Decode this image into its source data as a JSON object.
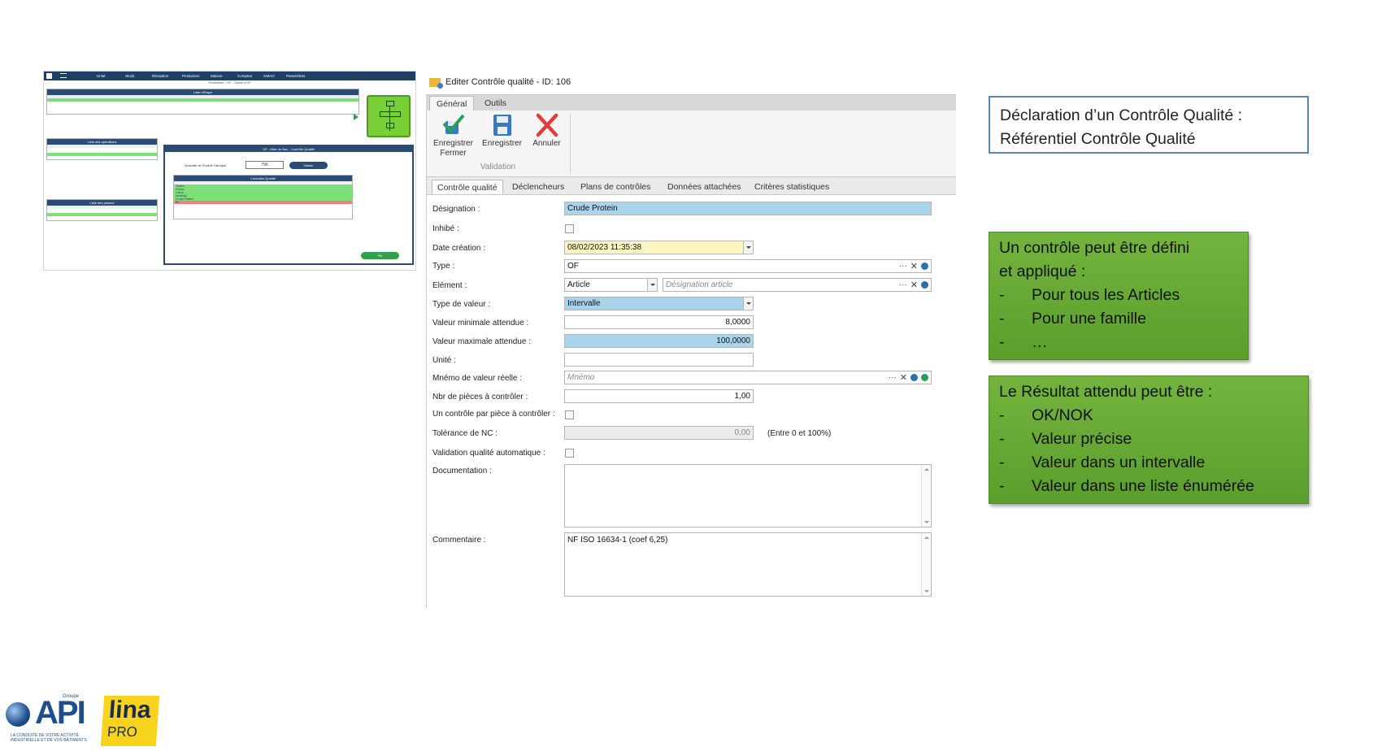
{
  "thumbnail": {
    "nav": [
      "Unité",
      "Stock",
      "Réception",
      "Production",
      "Maison",
      "Comptes",
      "GMAO",
      "Paramètres"
    ],
    "subtitle": "Production - OF - Saisie d'OF",
    "liste_etape_title": "Liste d'Etape",
    "liste_operation_title": "Liste des opérations",
    "liste_phases_title": "Liste des phases",
    "panel_title": "OF - Mise en Bac - Contrôle Qualité",
    "quantite_label": "Quantité de Produit Fabriqué",
    "quantite_value": "790",
    "valider_label": "Valider",
    "controles_title": "Contrôles Qualité",
    "fin_label": "Fin",
    "controle_rows": [
      "Texture",
      "Colour",
      "Odour",
      "Humidity",
      "Crude Protein",
      "Ph"
    ]
  },
  "dialog": {
    "title": "Editer Contrôle qualité - ID: 106",
    "ribbon_tabs": [
      "Général",
      "Outils"
    ],
    "ribbon_buttons": {
      "save_close": "Enregistrer Fermer",
      "save": "Enregistrer",
      "cancel": "Annuler"
    },
    "ribbon_group": "Validation",
    "form_tabs": [
      "Contrôle qualité",
      "Déclencheurs",
      "Plans de contrôles",
      "Données attachées",
      "Critères statistiques"
    ],
    "fields": {
      "designation": {
        "label": "Désignation :",
        "value": "Crude Protein"
      },
      "inhibe": {
        "label": "Inhibé :",
        "checked": false
      },
      "date_creation": {
        "label": "Date création :",
        "value": "08/02/2023 11:35:38"
      },
      "type": {
        "label": "Type :",
        "value": "OF"
      },
      "element": {
        "label": "Elément :",
        "value": "Article",
        "placeholder": "Désignation article"
      },
      "type_valeur": {
        "label": "Type de valeur :",
        "value": "Intervalle"
      },
      "valeur_min": {
        "label": "Valeur minimale attendue :",
        "value": "8,0000"
      },
      "valeur_max": {
        "label": "Valeur maximale attendue :",
        "value": "100,0000"
      },
      "unite": {
        "label": "Unité :",
        "value": ""
      },
      "mnemo": {
        "label": "Mnémo de valeur réelle :",
        "placeholder": "Mnémo"
      },
      "nbr_pieces": {
        "label": "Nbr de pièces à contrôler :",
        "value": "1,00"
      },
      "controle_par_piece": {
        "label": "Un contrôle par pièce à contrôler :",
        "checked": false
      },
      "tolerance": {
        "label": "Tolérance de NC :",
        "value": "0,00",
        "hint": "(Entre 0 et 100%)"
      },
      "validation_auto": {
        "label": "Validation qualité automatique :",
        "checked": false
      },
      "documentation": {
        "label": "Documentation :",
        "value": ""
      },
      "commentaire": {
        "label": "Commentaire :",
        "value": "NF ISO 16634-1 (coef 6,25)"
      }
    }
  },
  "callouts": {
    "title_lines": [
      "Déclaration d’un Contrôle Qualité :",
      "Référentiel Contrôle Qualité"
    ],
    "box1": {
      "intro_lines": [
        "Un contrôle peut être défini",
        "et appliqué :"
      ],
      "items": [
        "Pour tous les Articles",
        "Pour une famille",
        "…"
      ]
    },
    "box2": {
      "intro": "Le Résultat attendu peut être :",
      "items": [
        "OK/NOK",
        "Valeur précise",
        "Valeur dans un intervalle",
        "Valeur dans une liste énumérée"
      ]
    }
  },
  "logos": {
    "api_group": "Groupe",
    "api_name": "API",
    "api_tagline": "LA CONDUITE DE VOTRE ACTIVITÉ INDUSTRIELLE ET DE VOS BÂTIMENTS",
    "lina_name": "lina",
    "lina_pro": "PRO"
  },
  "colors": {
    "field_blue": "#a9d5ec",
    "field_yellow": "#fff6c2",
    "callout_green": "#68aa35",
    "title_border": "#5b86b8",
    "cancel_red": "#e23b3b",
    "save_blue": "#3a78c2"
  }
}
